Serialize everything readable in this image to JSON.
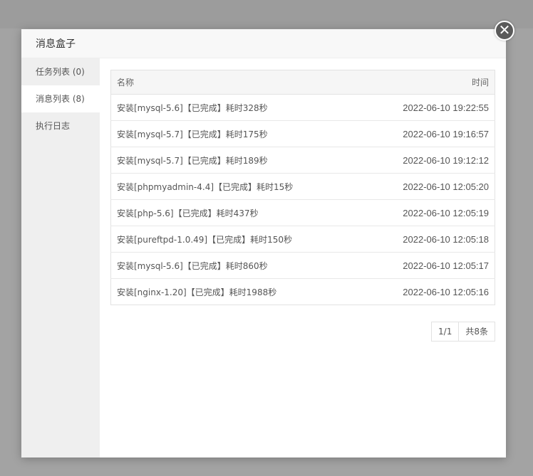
{
  "dialog": {
    "title": "消息盒子",
    "close_glyph": "✕"
  },
  "sidebar": {
    "items": [
      {
        "label": "任务列表 (0)",
        "active": false
      },
      {
        "label": "消息列表 (8)",
        "active": true
      },
      {
        "label": "执行日志",
        "active": false
      }
    ]
  },
  "table": {
    "headers": {
      "name": "名称",
      "time": "时间"
    },
    "rows": [
      {
        "name": "安装[mysql-5.6]【已完成】耗时328秒",
        "time": "2022-06-10 19:22:55"
      },
      {
        "name": "安装[mysql-5.7]【已完成】耗时175秒",
        "time": "2022-06-10 19:16:57"
      },
      {
        "name": "安装[mysql-5.7]【已完成】耗时189秒",
        "time": "2022-06-10 19:12:12"
      },
      {
        "name": "安装[phpmyadmin-4.4]【已完成】耗时15秒",
        "time": "2022-06-10 12:05:20"
      },
      {
        "name": "安装[php-5.6]【已完成】耗时437秒",
        "time": "2022-06-10 12:05:19"
      },
      {
        "name": "安装[pureftpd-1.0.49]【已完成】耗时150秒",
        "time": "2022-06-10 12:05:18"
      },
      {
        "name": "安装[mysql-5.6]【已完成】耗时860秒",
        "time": "2022-06-10 12:05:17"
      },
      {
        "name": "安装[nginx-1.20]【已完成】耗时1988秒",
        "time": "2022-06-10 12:05:16"
      }
    ]
  },
  "pager": {
    "page": "1/1",
    "total": "共8条"
  }
}
